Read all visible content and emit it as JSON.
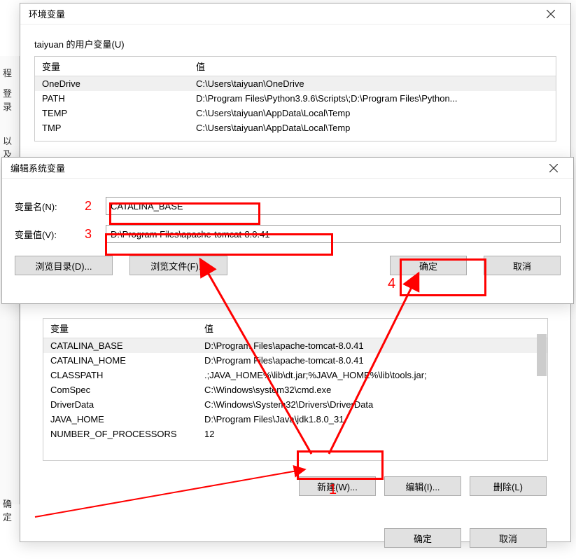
{
  "left_frag": {
    "item1": "程",
    "item2": "登录",
    "item3": "以及",
    "item4": "确定"
  },
  "dialog_env": {
    "title": "环境变量",
    "user_vars_label": "taiyuan 的用户变量(U)",
    "col_var": "变量",
    "col_val": "值",
    "user_rows": [
      {
        "var": "OneDrive",
        "val": "C:\\Users\\taiyuan\\OneDrive"
      },
      {
        "var": "PATH",
        "val": "D:\\Program Files\\Python3.9.6\\Scripts\\;D:\\Program Files\\Python..."
      },
      {
        "var": "TEMP",
        "val": "C:\\Users\\taiyuan\\AppData\\Local\\Temp"
      },
      {
        "var": "TMP",
        "val": "C:\\Users\\taiyuan\\AppData\\Local\\Temp"
      }
    ],
    "sys_rows": [
      {
        "var": "CATALINA_BASE",
        "val": "D:\\Program Files\\apache-tomcat-8.0.41"
      },
      {
        "var": "CATALINA_HOME",
        "val": "D:\\Program Files\\apache-tomcat-8.0.41"
      },
      {
        "var": "CLASSPATH",
        "val": ".;JAVA_HOME%\\lib\\dt.jar;%JAVA_HOME%\\lib\\tools.jar;"
      },
      {
        "var": "ComSpec",
        "val": "C:\\Windows\\system32\\cmd.exe"
      },
      {
        "var": "DriverData",
        "val": "C:\\Windows\\System32\\Drivers\\DriverData"
      },
      {
        "var": "JAVA_HOME",
        "val": "D:\\Program Files\\Java\\jdk1.8.0_31"
      },
      {
        "var": "NUMBER_OF_PROCESSORS",
        "val": "12"
      }
    ],
    "sys_col_var": "变量",
    "sys_col_val": "值",
    "new_btn": "新建(W)...",
    "edit_btn": "编辑(I)...",
    "delete_btn": "删除(L)",
    "ok_btn": "确定",
    "cancel_btn": "取消"
  },
  "dialog_edit": {
    "title": "编辑系统变量",
    "name_label": "变量名(N):",
    "value_label": "变量值(V):",
    "name_value": "CATALINA_BASE",
    "value_value": "D:\\Program Files\\apache-tomcat-8.0.41",
    "browse_dir": "浏览目录(D)...",
    "browse_file": "浏览文件(F)...",
    "ok": "确定",
    "cancel": "取消"
  },
  "annotations": {
    "n1": "1",
    "n2": "2",
    "n3": "3",
    "n4": "4"
  }
}
